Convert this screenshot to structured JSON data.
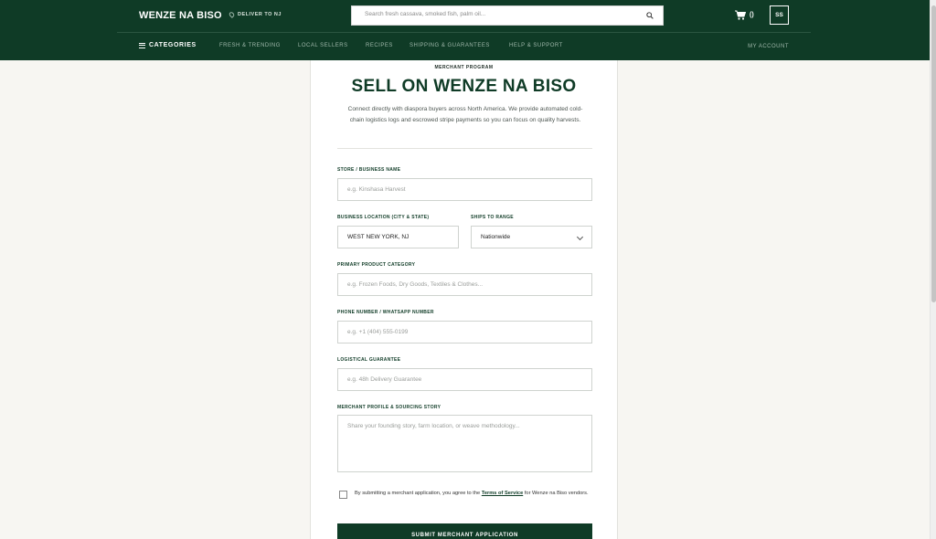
{
  "header": {
    "logo": "WENZE NA BISO",
    "deliver": "DELIVER TO NJ",
    "search_placeholder": "Search fresh cassava, smoked fish, palm oil...",
    "cart_count": "()",
    "avatar_initials": "SS"
  },
  "nav": {
    "categories": "CATEGORIES",
    "links": [
      "FRESH & TRENDING",
      "LOCAL SELLERS",
      "RECIPES",
      "SHIPPING & GUARANTEES",
      "HELP & SUPPORT"
    ],
    "account": "MY ACCOUNT"
  },
  "form": {
    "eyebrow": "MERCHANT PROGRAM",
    "title": "SELL ON WENZE NA BISO",
    "intro": "Connect directly with diaspora buyers across North America. We provide automated cold-chain logistics logs and escrowed stripe payments so you can focus on quality harvests.",
    "store_label": "STORE / BUSINESS NAME",
    "store_placeholder": "e.g. Kinshasa Harvest",
    "location_label": "BUSINESS LOCATION (CITY & STATE)",
    "location_value": "WEST NEW YORK, NJ",
    "ships_label": "SHIPS TO RANGE",
    "ships_value": "Nationwide",
    "category_label": "PRIMARY PRODUCT CATEGORY",
    "category_placeholder": "e.g. Frozen Foods, Dry Goods, Textiles & Clothes...",
    "phone_label": "PHONE NUMBER / WHATSAPP NUMBER",
    "phone_placeholder": "e.g. +1 (404) 555-0199",
    "guarantee_label": "LOGISTICAL GUARANTEE",
    "guarantee_placeholder": "e.g. 48h Delivery Guarantee",
    "profile_label": "MERCHANT PROFILE & SOURCING STORY",
    "profile_placeholder": "Share your founding story, farm location, or weave methodology...",
    "terms_prefix": "By submitting a merchant application, you agree to the",
    "terms_link": "Terms of Service",
    "terms_suffix": "for Wenze na Biso vendors.",
    "submit": "SUBMIT MERCHANT APPLICATION"
  },
  "colors": {
    "brand_green": "#0f3b26",
    "page_bg": "#f7f6f2"
  },
  "icons": [
    "location-pin-icon",
    "search-icon",
    "cart-icon",
    "menu-icon",
    "chevron-down-icon"
  ]
}
